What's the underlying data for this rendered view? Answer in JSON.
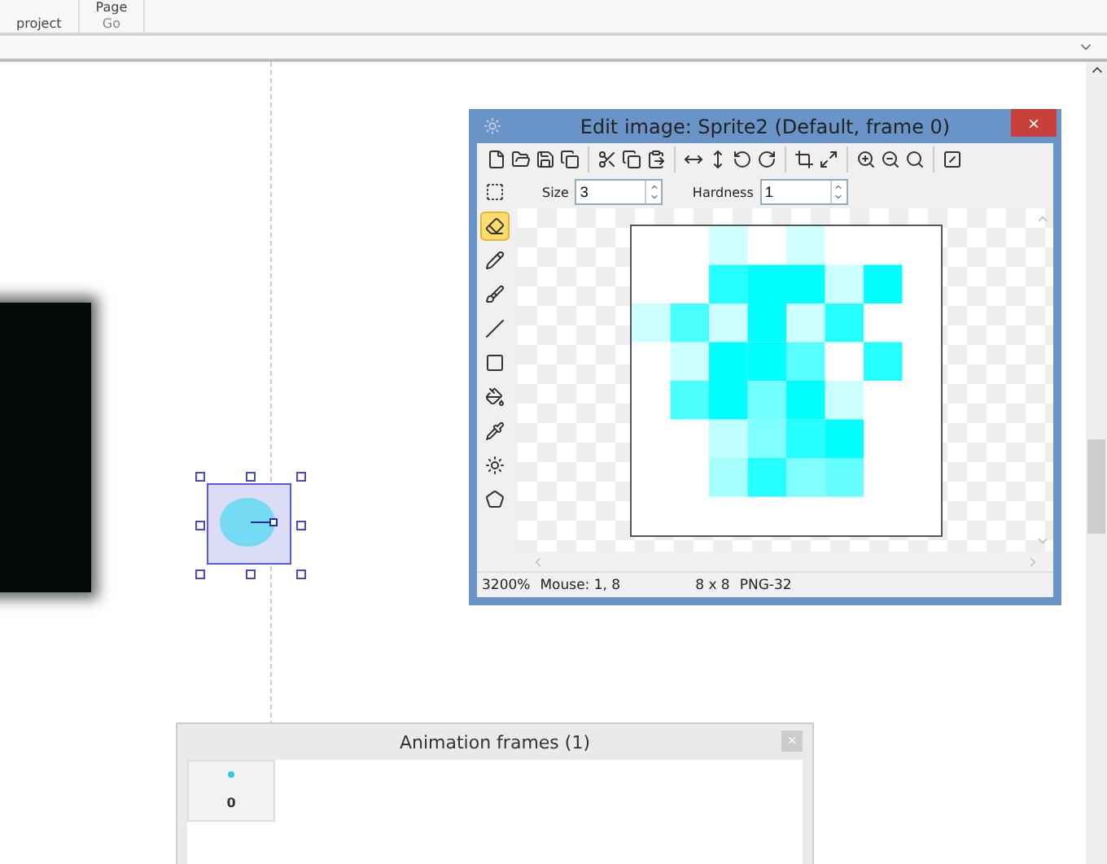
{
  "ribbon": {
    "groups": [
      {
        "label": "project"
      },
      {
        "label": "Page"
      },
      {
        "label": "Go"
      }
    ]
  },
  "editor": {
    "title": "Edit image: Sprite2 (Default, frame 0)",
    "close": "×",
    "tools": [
      {
        "selected": false
      },
      {
        "selected": true
      },
      {
        "selected": false
      },
      {
        "selected": false
      },
      {
        "selected": false
      },
      {
        "selected": false
      },
      {
        "selected": false
      },
      {
        "selected": false
      },
      {
        "selected": false
      },
      {
        "selected": false
      }
    ],
    "size": {
      "label": "Size",
      "value": "3"
    },
    "hardness": {
      "label": "Hardness",
      "value": "1"
    },
    "status": {
      "zoom": "3200%",
      "mouse": "Mouse: 1, 8",
      "dimensions": "8 x 8",
      "format": "PNG-32"
    }
  },
  "animation_frames": {
    "title": "Animation frames (1)",
    "close": "×",
    "frames": [
      {
        "label": "0",
        "selected": true
      }
    ]
  }
}
